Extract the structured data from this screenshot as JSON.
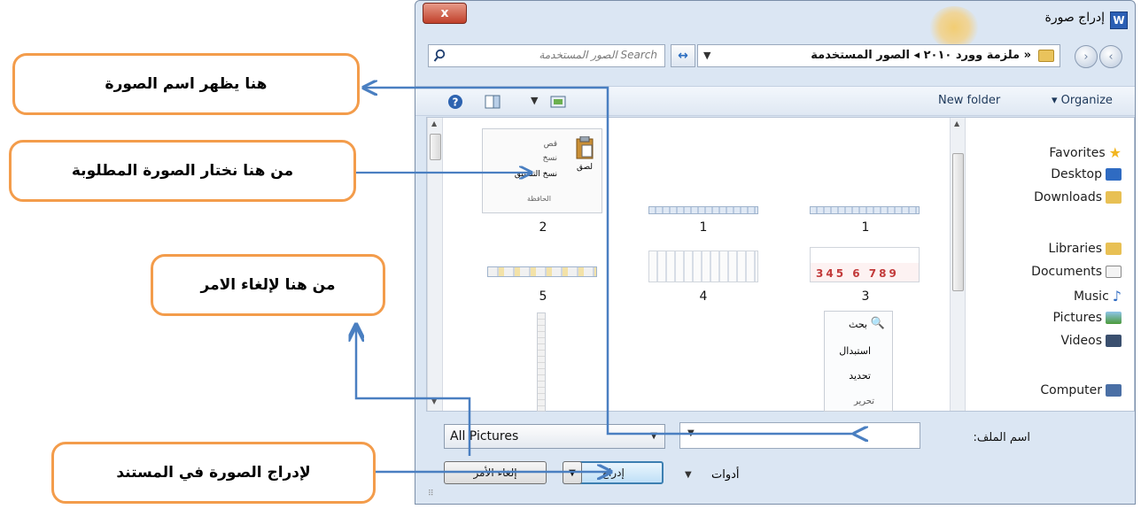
{
  "callouts": {
    "name_shown": "هنا يظهر اسم الصورة",
    "choose_image": "من هنا نختار الصورة المطلوبة",
    "cancel_here": "من هنا لإلغاء الامر",
    "insert_into_doc": "لإدراج الصورة  في المستند"
  },
  "dialog": {
    "title": "إدراج صورة",
    "close_label": "x",
    "app_badge": "W"
  },
  "address": {
    "path": "« ملزمة وورد ٢٠١٠ ◂ الصور المستخدمة",
    "search_placeholder": "Search الصور المستخدمة"
  },
  "toolbar": {
    "organize": "▾ Organize",
    "new_folder": "New folder",
    "help": "?"
  },
  "nav_pane": {
    "favorites": "Favorites",
    "desktop": "Desktop",
    "downloads": "Downloads",
    "libraries": "Libraries",
    "documents": "Documents",
    "music": "Music",
    "pictures": "Pictures",
    "videos": "Videos",
    "computer": "Computer"
  },
  "thumbnails": [
    {
      "label": "2"
    },
    {
      "label": "1"
    },
    {
      "label": "1"
    },
    {
      "label": "5"
    },
    {
      "label": "4"
    },
    {
      "label": "3"
    }
  ],
  "thumb_texts": {
    "paste": "لصق",
    "cut": "قص",
    "copy": "نسخ",
    "format_painter": "نسخ التنسيق",
    "clipboard": "الحافظة",
    "find": "بحث",
    "replace": "استبدال",
    "select": "تحديد",
    "editing": "تحرير"
  },
  "bottom": {
    "filename_label": "اسم الملف:",
    "filename_value": "",
    "filter_value": "All Pictures",
    "tools": "أدوات",
    "insert": "إدراج",
    "cancel": "إلغاء الأمر"
  },
  "colors": {
    "callout_border": "#f39c4b",
    "arrow": "#4a7fc1"
  }
}
